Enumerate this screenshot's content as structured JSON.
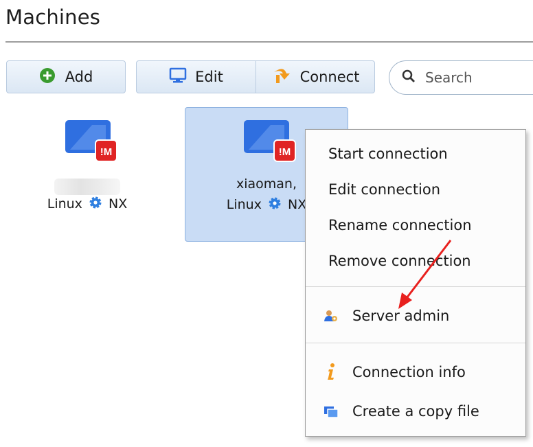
{
  "page": {
    "title": "Machines"
  },
  "toolbar": {
    "add_label": "Add",
    "edit_label": "Edit",
    "connect_label": "Connect"
  },
  "search": {
    "placeholder": "Search"
  },
  "machines": [
    {
      "name": "",
      "os": "Linux",
      "protocol": "NX"
    },
    {
      "name": "xiaoman,",
      "os": "Linux",
      "protocol": "NX"
    }
  ],
  "context_menu": {
    "start": "Start connection",
    "edit": "Edit connection",
    "rename": "Rename connection",
    "remove": "Remove connection",
    "server_admin": "Server admin",
    "connection_info": "Connection info",
    "create_copy": "Create a copy file"
  },
  "colors": {
    "accent_blue": "#2f6fe0",
    "nx_red": "#e02424",
    "add_green": "#3a9b2f",
    "connect_orange": "#f29a1d",
    "arrow_red": "#e8201e",
    "selection": "#c9dcf5"
  }
}
